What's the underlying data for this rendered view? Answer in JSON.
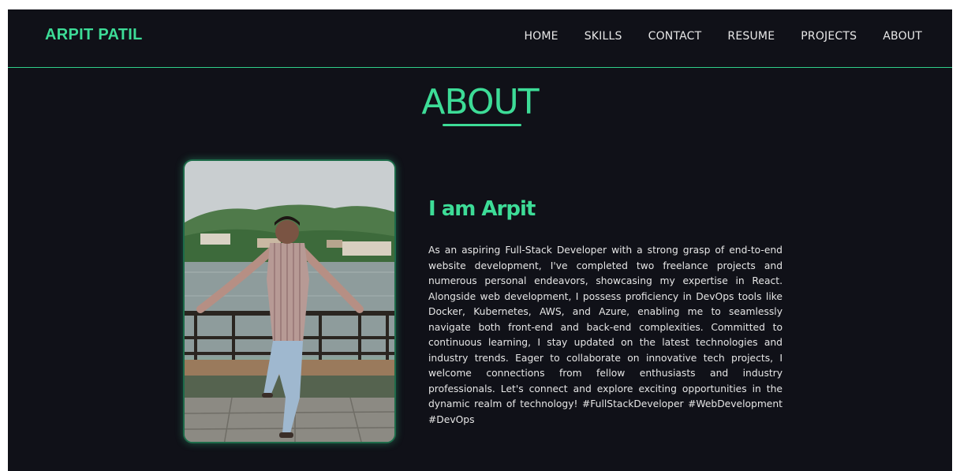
{
  "brand": {
    "name": "ARPIT PATIL"
  },
  "nav": {
    "items": [
      "HOME",
      "SKILLS",
      "CONTACT",
      "RESUME",
      "PROJECTS",
      "ABOUT"
    ]
  },
  "section": {
    "title": "ABOUT"
  },
  "about": {
    "heading": "I am Arpit",
    "paragraph": "As an aspiring Full-Stack Developer with a strong grasp of end-to-end website development, I've completed two freelance projects and numerous personal endeavors, showcasing my expertise in React. Alongside web development, I possess proficiency in DevOps tools like Docker, Kubernetes, AWS, and Azure, enabling me to seamlessly navigate both front-end and back-end complexities. Committed to continuous learning, I stay updated on the latest technologies and industry trends. Eager to collaborate on innovative tech projects, I welcome connections from fellow enthusiasts and industry professionals. Let's connect and explore exciting opportunities in the dynamic realm of technology! #FullStackDeveloper #WebDevelopment #DevOps"
  },
  "colors": {
    "accent": "#3ddc97",
    "background": "#101118",
    "text": "#e6e6e6"
  }
}
